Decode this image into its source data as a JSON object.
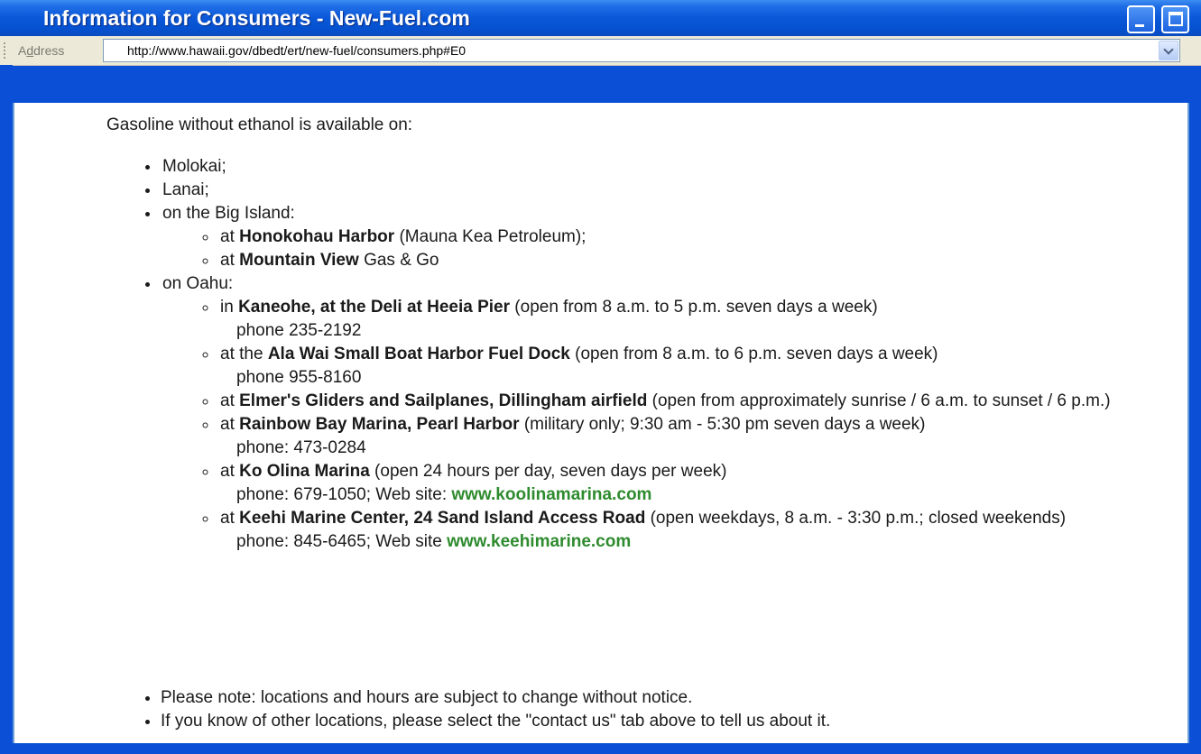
{
  "window": {
    "title": "Information for Consumers - New-Fuel.com",
    "minimize_icon": "minimize-icon",
    "maximize_icon": "maximize-icon"
  },
  "address_bar": {
    "label_prefix": "A",
    "label_underlined": "d",
    "label_suffix": "dress",
    "url": "http://www.hawaii.gov/dbedt/ert/new-fuel/consumers.php#E0",
    "dropdown_icon": "chevron-down-icon"
  },
  "content": {
    "intro": "Gasoline without ethanol is available on:",
    "islands": [
      {
        "label": "Molokai;"
      },
      {
        "label": "Lanai;"
      },
      {
        "label": "on the Big Island:"
      },
      {
        "label": "on Oahu:"
      }
    ],
    "big_island": [
      {
        "pre": "at ",
        "name": "Honokohau Harbor",
        "post": " (Mauna Kea Petroleum);"
      },
      {
        "pre": "at ",
        "name": "Mountain View",
        "post": " Gas & Go"
      }
    ],
    "oahu": [
      {
        "pre": "in ",
        "name": "Kaneohe, at the Deli at Heeia Pier",
        "post": " (open from 8 a.m. to 5 p.m. seven days a week)",
        "detail": "phone 235-2192"
      },
      {
        "pre": "at the ",
        "name": "Ala Wai Small Boat Harbor Fuel Dock",
        "post": " (open from 8 a.m. to 6 p.m. seven days a week)",
        "detail": "phone 955-8160"
      },
      {
        "pre": "at ",
        "name": "Elmer's Gliders and Sailplanes, Dillingham airfield",
        "post": " (open from approximately sunrise / 6 a.m. to sunset / 6 p.m.)"
      },
      {
        "pre": "at ",
        "name": "Rainbow Bay Marina, Pearl Harbor",
        "post": " (military only; 9:30 am - 5:30 pm seven days a week)",
        "detail": "phone: 473-0284"
      },
      {
        "pre": "at ",
        "name": "Ko Olina Marina",
        "post": " (open 24 hours per day, seven days per week)",
        "detail": "phone: 679-1050; Web site: ",
        "link": "www.koolinamarina.com"
      },
      {
        "pre": "at ",
        "name": "Keehi Marine Center, 24 Sand Island Access Road",
        "post": " (open weekdays, 8 a.m. - 3:30 p.m.; closed weekends)",
        "detail": "phone: 845-6465; Web site ",
        "link": "www.keehimarine.com"
      }
    ],
    "notes": [
      "Please note: locations and hours are subject to change without notice.",
      "If you know of other locations, please select the \"contact us\" tab above to tell us about it."
    ]
  },
  "colors": {
    "titlebar": "#0a58d8",
    "link": "#2e8b2e",
    "frame_border": "#6ea0d8"
  }
}
